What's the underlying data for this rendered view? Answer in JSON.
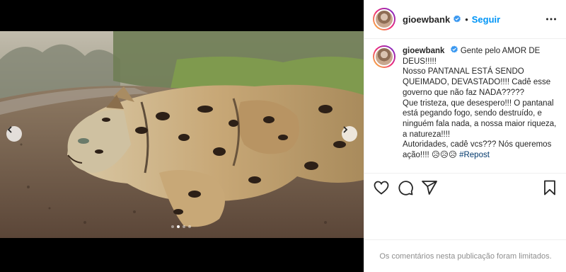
{
  "post": {
    "username": "gioewbank",
    "follow_label": "Seguir",
    "separator": "•",
    "caption": "Gente pelo AMOR DE DEUS!!!!!\nNosso PANTANAL ESTÁ SENDO QUEIMADO, DEVASTADO!!!! Cadê esse governo que não faz NADA?????\nQue tristeza, que desespero!!! O pantanal está pegando fogo, sendo destruído, e ninguém fala nada, a nossa maior riqueza, a natureza!!!!\nAutoridades, cadê vcs??? Nós queremos ação!!!! 😥😥😥 ",
    "hashtag": "#Repost",
    "comments_limited": "Os comentários nesta publicação foram limitados."
  },
  "carousel": {
    "slide_count": 4,
    "active_slide": 2
  },
  "icons": {
    "verified": "verified-badge-icon",
    "more": "more-options-icon",
    "prev": "chevron-left-icon",
    "next": "chevron-right-icon",
    "like": "heart-icon",
    "comment": "comment-icon",
    "share": "share-icon",
    "save": "bookmark-icon"
  },
  "colors": {
    "link_blue": "#0095f6",
    "hashtag": "#00376b",
    "muted": "#8e8e8e"
  }
}
